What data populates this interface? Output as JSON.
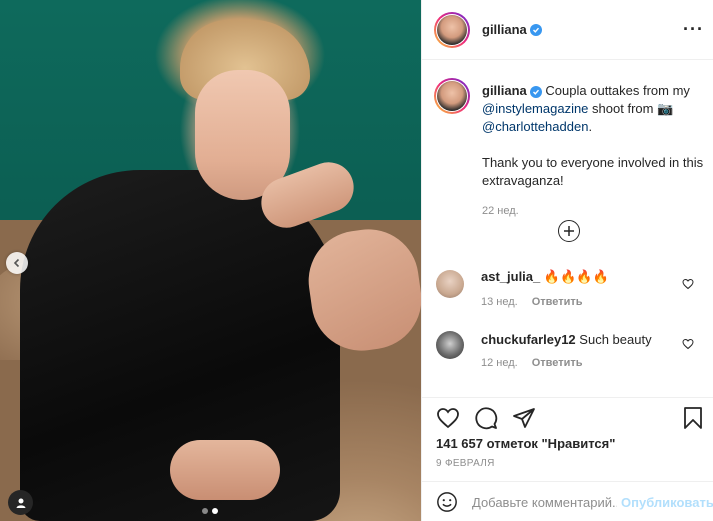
{
  "post": {
    "username": "gilliana",
    "caption_parts": {
      "text1": "Coupla outtakes from my",
      "mention1": "@instylemagazine",
      "text2": "shoot from",
      "camera": "📷",
      "mention2": "@charlottehadden",
      "text3": ".",
      "paragraph2": "Thank you to everyone involved in this extravaganza!"
    },
    "caption_time": "22 нед.",
    "carousel_dots": 2,
    "carousel_active": 2
  },
  "comments": [
    {
      "username": "ast_julia_",
      "text": "🔥🔥🔥🔥",
      "time": "13 нед.",
      "reply": "Ответить"
    },
    {
      "username": "chuckufarley12",
      "text": "Such beauty",
      "time": "12 нед.",
      "reply": "Ответить"
    }
  ],
  "actions": {
    "likes_text": "141 657 отметок \"Нравится\"",
    "date": "9 ФЕВРАЛЯ"
  },
  "add_comment": {
    "placeholder": "Добавьте комментарий...",
    "post_label": "Опубликовать"
  },
  "colors": {
    "verified": "#3897f0",
    "link": "#00376b",
    "post_button": "#b2dffc"
  }
}
